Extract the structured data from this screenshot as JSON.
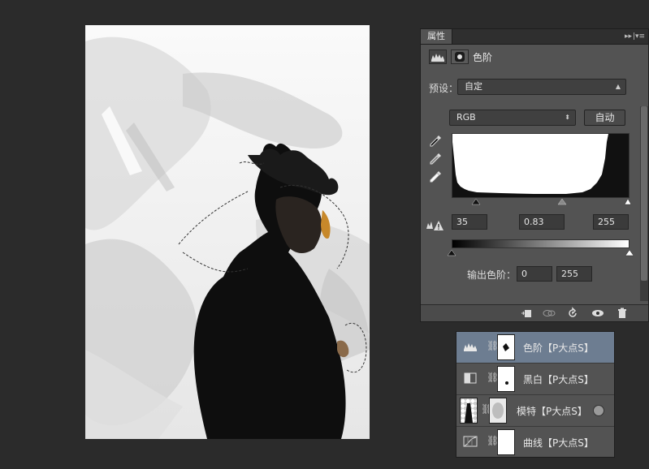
{
  "properties_panel": {
    "tab_label": "属性",
    "collapse_glyph": "▸▸",
    "menu_glyph": "|▾≡",
    "adjustment_title": "色阶",
    "preset_label": "预设：",
    "preset_value": "自定",
    "channel_value": "RGB",
    "auto_button": "自动",
    "input_black": "35",
    "input_gamma": "0.83",
    "input_white": "255",
    "output_label": "输出色阶：",
    "output_black": "0",
    "output_white": "255",
    "icons": [
      "levels-icon",
      "mask-icon",
      "black-eyedropper-icon",
      "gray-eyedropper-icon",
      "white-eyedropper-icon",
      "clipping-warning-icon",
      "clip-to-layer-icon",
      "view-previous-icon",
      "reset-icon",
      "visibility-eye-icon",
      "trash-icon"
    ]
  },
  "layers_panel": {
    "layers": [
      {
        "name": "色阶【P大点S】",
        "type": "levels-adjustment",
        "selected": true
      },
      {
        "name": "黑白【P大点S】",
        "type": "black-white-adjustment",
        "selected": false
      },
      {
        "name": "模特【P大点S】",
        "type": "pixel-layer",
        "selected": false
      },
      {
        "name": "曲线【P大点S】",
        "type": "curves-adjustment",
        "selected": false
      }
    ]
  },
  "colors": {
    "app_background": "#2b2b2b",
    "panel": "#535353",
    "selected_layer": "#6d7d91"
  }
}
